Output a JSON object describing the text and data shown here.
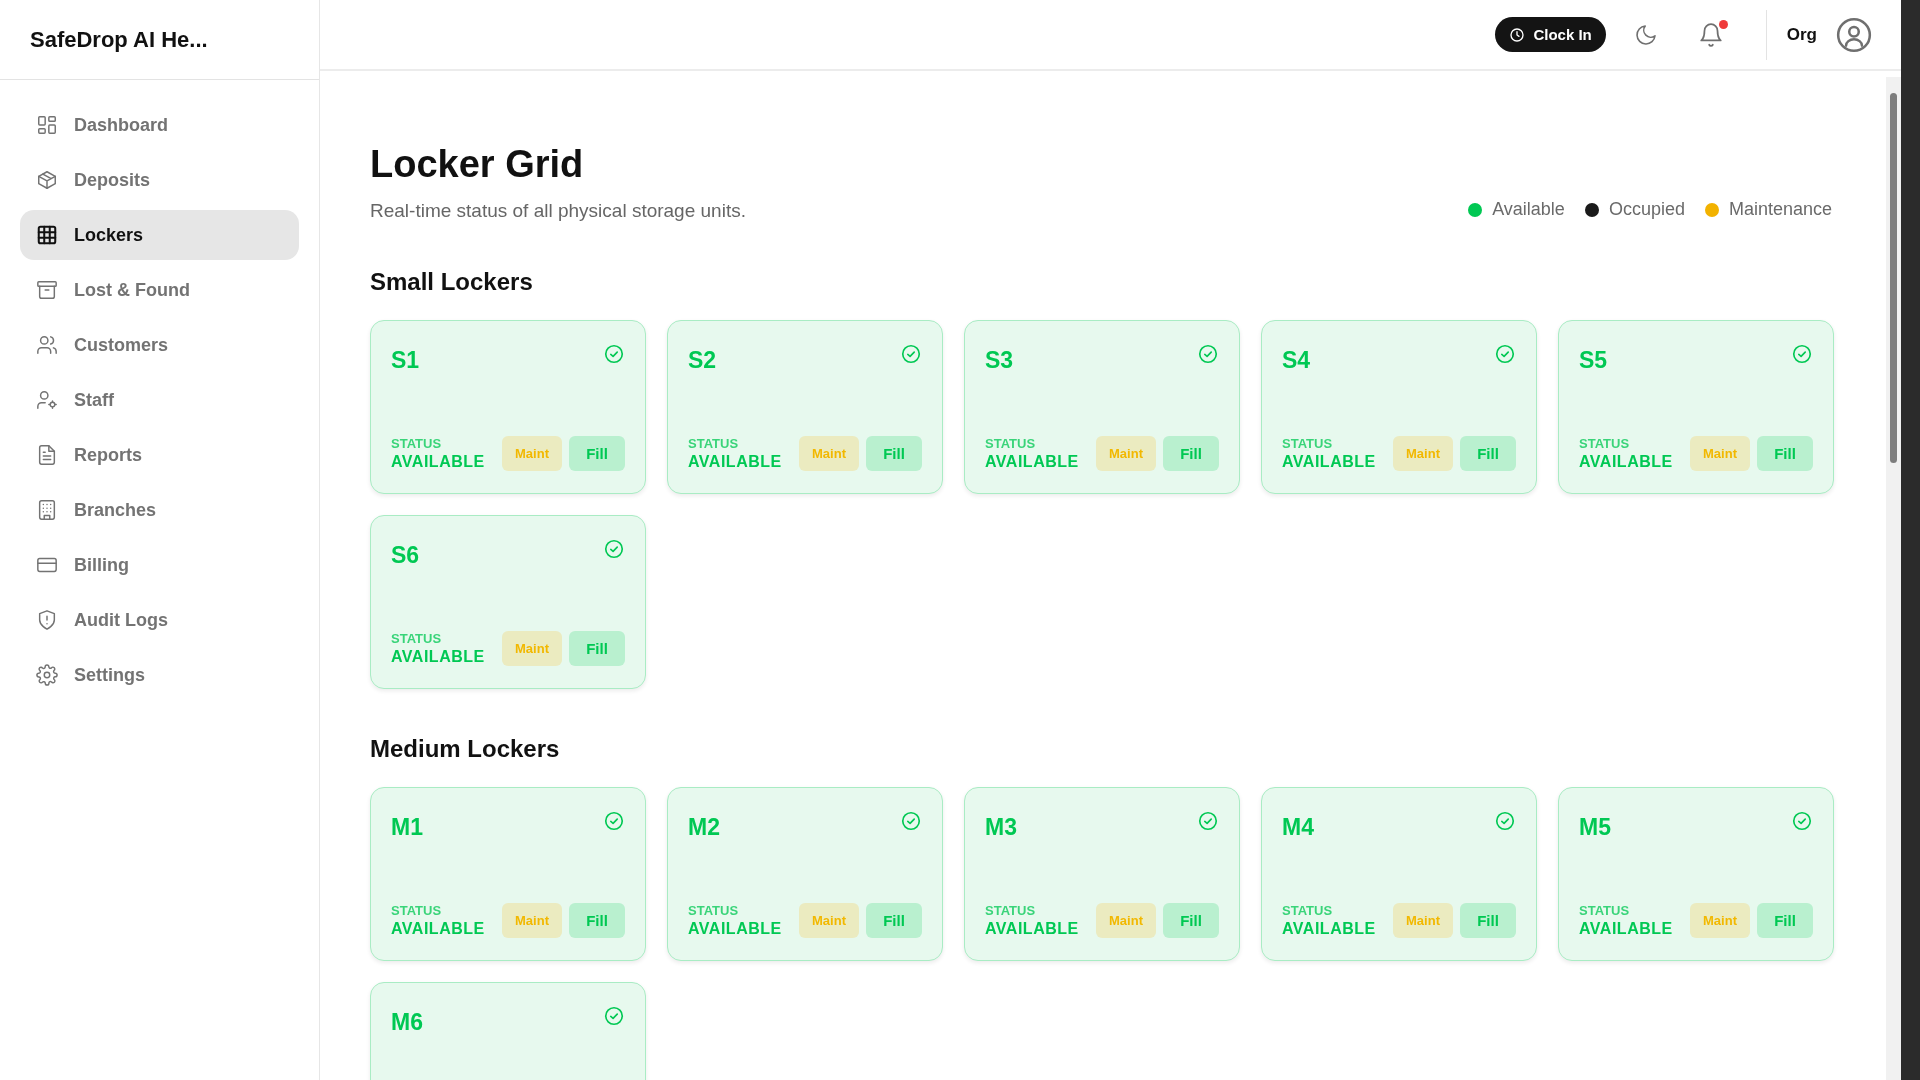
{
  "sidebar": {
    "brand": "SafeDrop AI He...",
    "items": [
      {
        "label": "Dashboard",
        "selected": false
      },
      {
        "label": "Deposits",
        "selected": false
      },
      {
        "label": "Lockers",
        "selected": true
      },
      {
        "label": "Lost & Found",
        "selected": false
      },
      {
        "label": "Customers",
        "selected": false
      },
      {
        "label": "Staff",
        "selected": false
      },
      {
        "label": "Reports",
        "selected": false
      },
      {
        "label": "Branches",
        "selected": false
      },
      {
        "label": "Billing",
        "selected": false
      },
      {
        "label": "Audit Logs",
        "selected": false
      },
      {
        "label": "Settings",
        "selected": false
      }
    ]
  },
  "header": {
    "clock_button": "Clock In",
    "notification_unread": true,
    "org": "Org"
  },
  "page": {
    "title": "Locker Grid",
    "subtitle": "Real-time status of all physical storage units.",
    "legend": [
      {
        "label": "Available",
        "color": "#00c853"
      },
      {
        "label": "Occupied",
        "color": "#1a1a1a"
      },
      {
        "label": "Maintenance",
        "color": "#f2b200"
      }
    ],
    "sections": [
      {
        "title": "Small Lockers",
        "lockers": [
          {
            "label": "S1",
            "kind": "available",
            "status_label": "STATUS",
            "status": "AVAILABLE",
            "actions": [
              "Maint",
              "Fill"
            ]
          },
          {
            "label": "S2",
            "kind": "available",
            "status_label": "STATUS",
            "status": "AVAILABLE",
            "actions": [
              "Maint",
              "Fill"
            ]
          },
          {
            "label": "S3",
            "kind": "available",
            "status_label": "STATUS",
            "status": "AVAILABLE",
            "actions": [
              "Maint",
              "Fill"
            ]
          },
          {
            "label": "S4",
            "kind": "available",
            "status_label": "STATUS",
            "status": "AVAILABLE",
            "actions": [
              "Maint",
              "Fill"
            ]
          },
          {
            "label": "S5",
            "kind": "available",
            "status_label": "STATUS",
            "status": "AVAILABLE",
            "actions": [
              "Maint",
              "Fill"
            ]
          },
          {
            "label": "S6",
            "kind": "available",
            "status_label": "STATUS",
            "status": "AVAILABLE",
            "actions": [
              "Maint",
              "Fill"
            ]
          }
        ]
      },
      {
        "title": "Medium Lockers",
        "lockers": [
          {
            "label": "M1",
            "kind": "available",
            "status_label": "STATUS",
            "status": "AVAILABLE",
            "actions": [
              "Maint",
              "Fill"
            ]
          },
          {
            "label": "M2",
            "kind": "available",
            "status_label": "STATUS",
            "status": "AVAILABLE",
            "actions": [
              "Maint",
              "Fill"
            ]
          },
          {
            "label": "M3",
            "kind": "available",
            "status_label": "STATUS",
            "status": "AVAILABLE",
            "actions": [
              "Maint",
              "Fill"
            ]
          },
          {
            "label": "M4",
            "kind": "available",
            "status_label": "STATUS",
            "status": "AVAILABLE",
            "actions": [
              "Maint",
              "Fill"
            ]
          },
          {
            "label": "M5",
            "kind": "available",
            "status_label": "STATUS",
            "status": "AVAILABLE",
            "actions": [
              "Maint",
              "Fill"
            ]
          },
          {
            "label": "M6",
            "kind": "available"
          }
        ]
      }
    ]
  }
}
